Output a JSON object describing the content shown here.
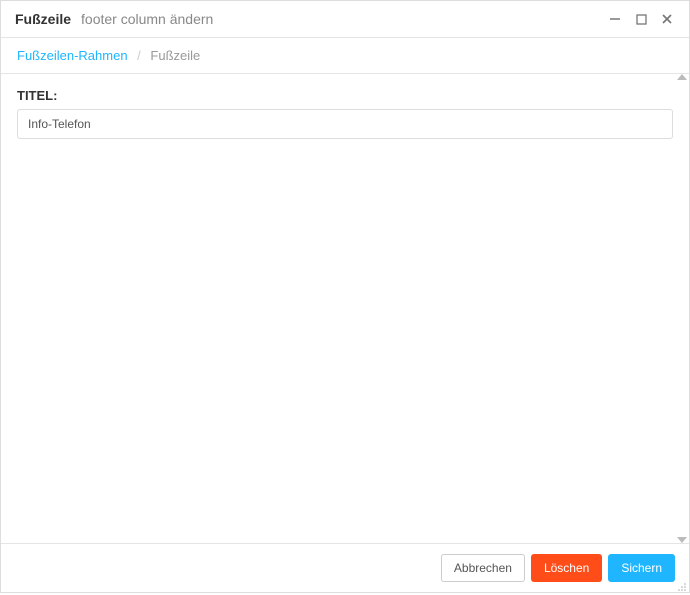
{
  "titlebar": {
    "title": "Fußzeile",
    "subtitle": "footer column ändern"
  },
  "breadcrumb": {
    "link": "Fußzeilen-Rahmen",
    "separator": "/",
    "current": "Fußzeile"
  },
  "form": {
    "title_label": "TITEL:",
    "title_value": "Info-Telefon"
  },
  "footer": {
    "cancel": "Abbrechen",
    "delete": "Löschen",
    "save": "Sichern"
  }
}
